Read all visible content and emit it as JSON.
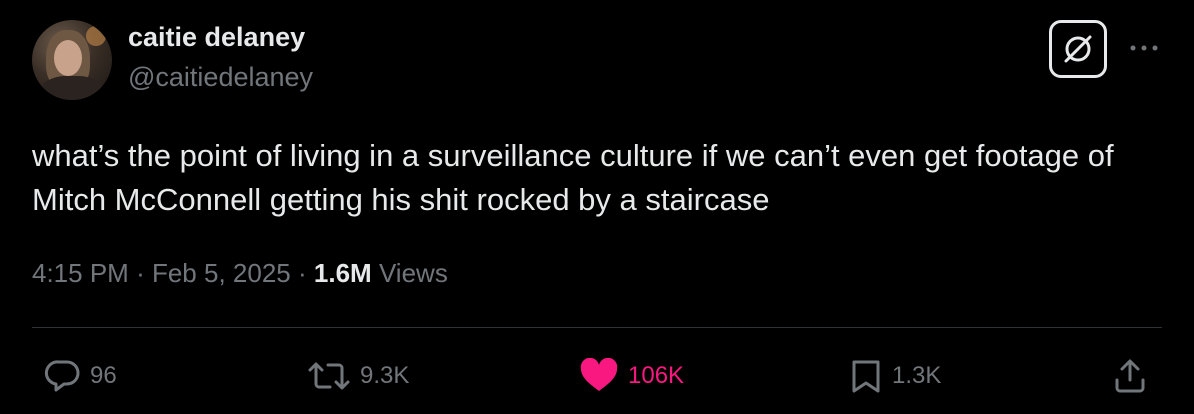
{
  "author": {
    "display_name": "caitie delaney",
    "handle": "@caitiedelaney"
  },
  "tweet": {
    "text": "what’s the point of living in a surveillance culture if we can’t even get footage of Mitch McConnell getting his shit rocked by a staircase"
  },
  "meta": {
    "time": "4:15 PM",
    "date": "Feb 5, 2025",
    "views_count": "1.6M",
    "views_label": "Views",
    "separator": "·"
  },
  "actions": {
    "replies": "96",
    "reposts": "9.3K",
    "likes": "106K",
    "bookmarks": "1.3K"
  },
  "icons": {
    "grok": "grok-icon",
    "more": "more-icon",
    "reply": "reply-icon",
    "repost": "repost-icon",
    "like": "heart-icon",
    "bookmark": "bookmark-icon",
    "share": "share-icon"
  },
  "colors": {
    "background": "#000000",
    "text_primary": "#e7e9ea",
    "text_secondary": "#71767b",
    "like_active": "#f91880",
    "divider": "#2f3336"
  }
}
